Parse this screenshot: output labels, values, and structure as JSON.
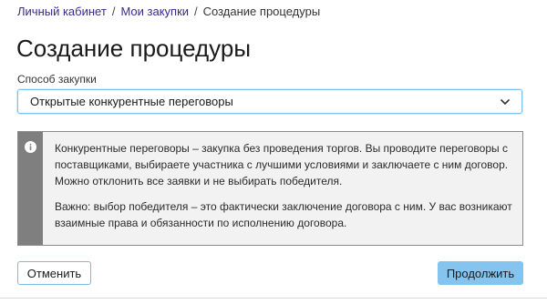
{
  "breadcrumb": {
    "items": [
      {
        "label": "Личный кабинет"
      },
      {
        "label": "Мои закупки"
      },
      {
        "label": "Создание процедуры"
      }
    ],
    "separator": "/"
  },
  "page_title": "Создание процедуры",
  "procurement_method": {
    "label": "Способ закупки",
    "selected_value": "Открытые конкурентные переговоры"
  },
  "info_panel": {
    "icon": "info-icon",
    "paragraph_1": "Конкурентные переговоры – закупка без проведения торгов. Вы проводите переговоры с поставщиками, выбираете участника с лучшими условиями и заключаете с ним договор. Можно отклонить все заявки и не выбирать победителя.",
    "paragraph_2": "Важно: выбор победителя – это фактически заключение договора с ним. У вас возникают взаимные права и обязанности по исполнению договора."
  },
  "actions": {
    "cancel_label": "Отменить",
    "submit_label": "Продолжить"
  },
  "colors": {
    "link": "#3a2a8c",
    "select_border": "#7ec3ee",
    "panel_background": "#f2f2f2",
    "panel_stripe": "#7f7f7f",
    "primary_button": "#85c4ee"
  }
}
